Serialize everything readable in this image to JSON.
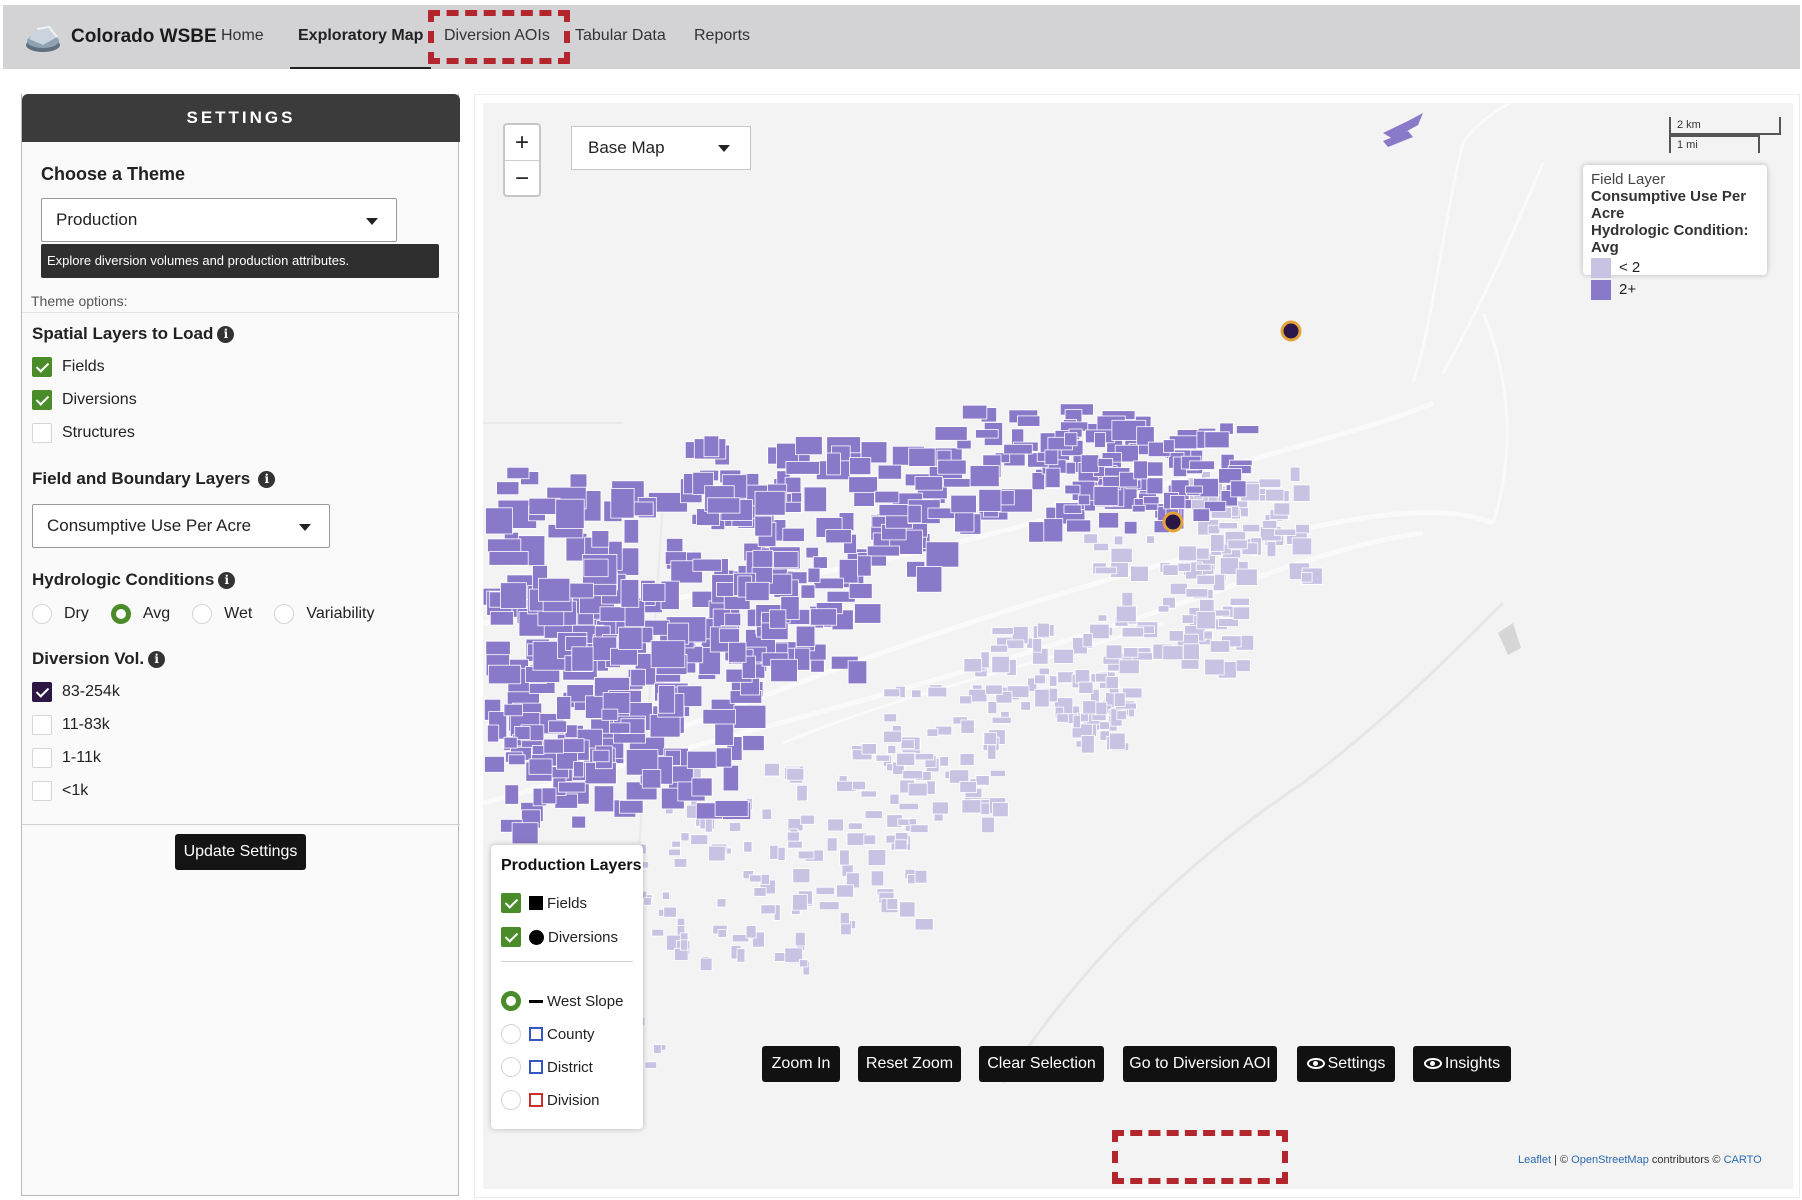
{
  "app": {
    "title": "Colorado WSBE"
  },
  "nav": {
    "items": [
      {
        "label": "Home"
      },
      {
        "label": "Exploratory Map"
      },
      {
        "label": "Diversion AOIs"
      },
      {
        "label": "Tabular Data"
      },
      {
        "label": "Reports"
      }
    ],
    "active": "Exploratory Map"
  },
  "settings": {
    "header": "SETTINGS",
    "theme_label": "Choose a Theme",
    "theme_value": "Production",
    "theme_tooltip": "Explore diversion volumes and production attributes.",
    "theme_options_label": "Theme options:",
    "spatial_layers": {
      "label": "Spatial Layers to Load",
      "items": [
        {
          "label": "Fields",
          "checked": true
        },
        {
          "label": "Diversions",
          "checked": true
        },
        {
          "label": "Structures",
          "checked": false
        }
      ]
    },
    "field_boundary": {
      "label": "Field and Boundary Layers",
      "value": "Consumptive Use Per Acre"
    },
    "hydrologic": {
      "label": "Hydrologic Conditions",
      "options": [
        {
          "label": "Dry",
          "selected": false
        },
        {
          "label": "Avg",
          "selected": true
        },
        {
          "label": "Wet",
          "selected": false
        },
        {
          "label": "Variability",
          "selected": false
        }
      ]
    },
    "diversion_vol": {
      "label": "Diversion Vol.",
      "items": [
        {
          "label": "83-254k",
          "checked": true
        },
        {
          "label": "11-83k",
          "checked": false
        },
        {
          "label": "1-11k",
          "checked": false
        },
        {
          "label": "<1k",
          "checked": false
        }
      ]
    },
    "update_button": "Update Settings",
    "info_glyph": "i"
  },
  "map": {
    "zoom_in": "+",
    "zoom_out": "−",
    "basemap_label": "Base Map",
    "scale": {
      "km": "2 km",
      "mi": "1 mi"
    },
    "field_legend": {
      "title": "Field Layer",
      "line1": "Consumptive Use Per Acre",
      "line2": "Hydrologic Condition: Avg",
      "classes": [
        {
          "label": "< 2",
          "color": "#c9c3e3"
        },
        {
          "label": "2+",
          "color": "#8a78c8"
        }
      ]
    },
    "production_legend": {
      "title": "Production Layers",
      "layers": [
        {
          "label": "Fields",
          "checked": true
        },
        {
          "label": "Diversions",
          "checked": true
        }
      ],
      "boundaries": [
        {
          "label": "West Slope",
          "selected": true
        },
        {
          "label": "County",
          "selected": false
        },
        {
          "label": "District",
          "selected": false
        },
        {
          "label": "Division",
          "selected": false
        }
      ]
    },
    "buttons": {
      "zoom_in": "Zoom In",
      "reset_zoom": "Reset Zoom",
      "clear_selection": "Clear Selection",
      "go_to_aoi": "Go to Diversion AOI",
      "settings": "Settings",
      "insights": "Insights"
    },
    "attribution": {
      "leaflet": "Leaflet",
      "sep": " | © ",
      "osm": "OpenStreetMap",
      "contrib": " contributors © ",
      "carto": "CARTO"
    },
    "colors": {
      "high": "#8a78c8",
      "low": "#c9c3e3",
      "accent": "#4b8c2a",
      "highlight": "#b3262d"
    }
  }
}
